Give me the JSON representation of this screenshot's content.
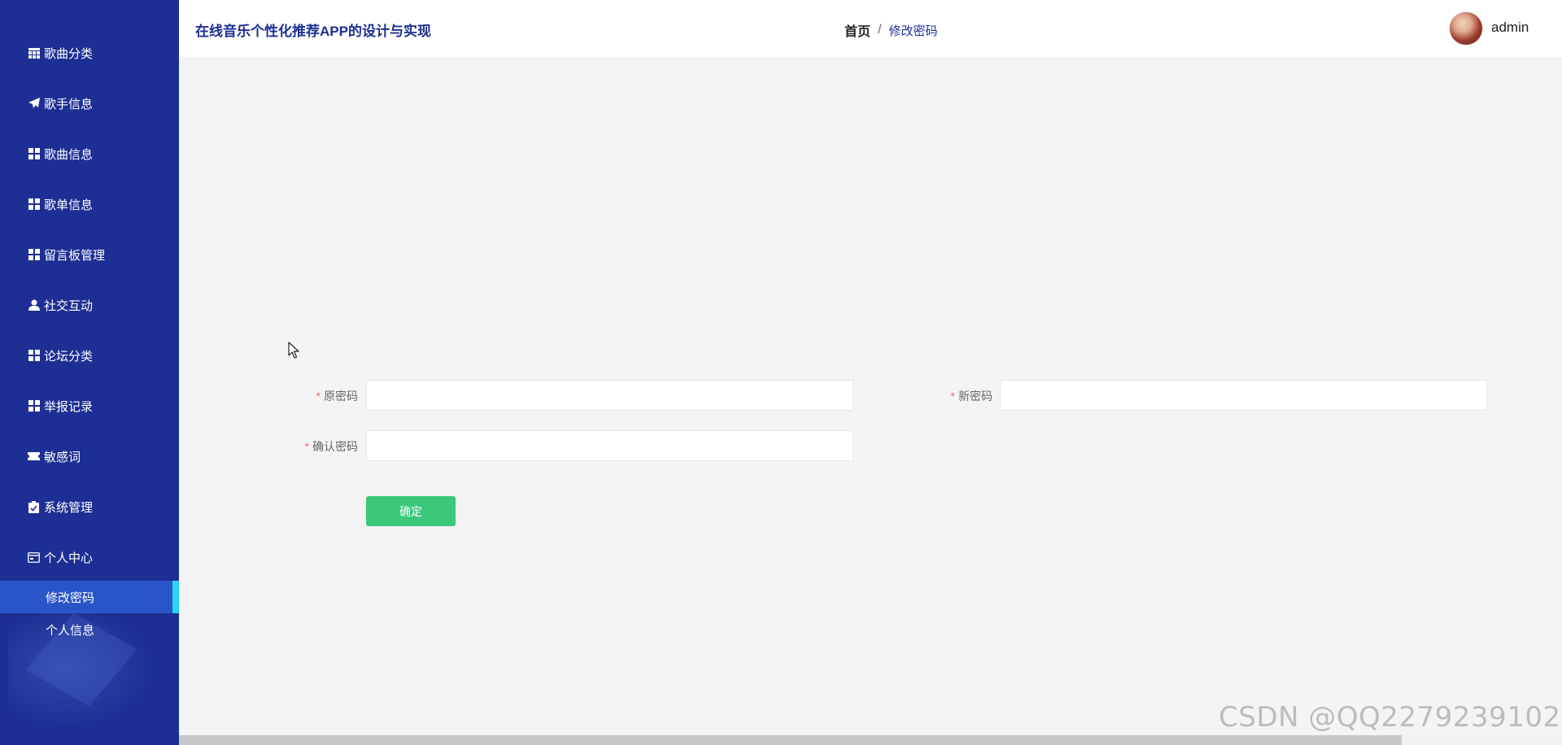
{
  "app": {
    "title": "在线音乐个性化推荐APP的设计与实现"
  },
  "sidebar": {
    "items": [
      {
        "label": "歌曲分类",
        "icon": "table-icon"
      },
      {
        "label": "歌手信息",
        "icon": "paper-plane-icon"
      },
      {
        "label": "歌曲信息",
        "icon": "grid-icon"
      },
      {
        "label": "歌单信息",
        "icon": "grid-icon"
      },
      {
        "label": "留言板管理",
        "icon": "grid-icon"
      },
      {
        "label": "社交互动",
        "icon": "user-icon"
      },
      {
        "label": "论坛分类",
        "icon": "grid-icon"
      },
      {
        "label": "举报记录",
        "icon": "grid-icon"
      },
      {
        "label": "敏感词",
        "icon": "ticket-icon"
      },
      {
        "label": "系统管理",
        "icon": "clipboard-icon"
      },
      {
        "label": "个人中心",
        "icon": "card-icon"
      }
    ],
    "sub_items": [
      {
        "label": "修改密码",
        "active": true
      },
      {
        "label": "个人信息",
        "active": false
      }
    ]
  },
  "header": {
    "breadcrumb_home": "首页",
    "breadcrumb_sep": "/",
    "breadcrumb_current": "修改密码",
    "username": "admin"
  },
  "form": {
    "required_mark": "*",
    "old_password_label": "原密码",
    "old_password_value": "",
    "new_password_label": "新密码",
    "new_password_value": "",
    "confirm_password_label": "确认密码",
    "confirm_password_value": "",
    "submit_label": "确定"
  },
  "watermark": "CSDN @QQ2279239102",
  "colors": {
    "sidebar_bg": "#1d2f94",
    "active_item_bg": "#2a55c9",
    "active_indicator": "#27d6f5",
    "submit_button": "#3cc87a",
    "required": "#f56c6c"
  }
}
